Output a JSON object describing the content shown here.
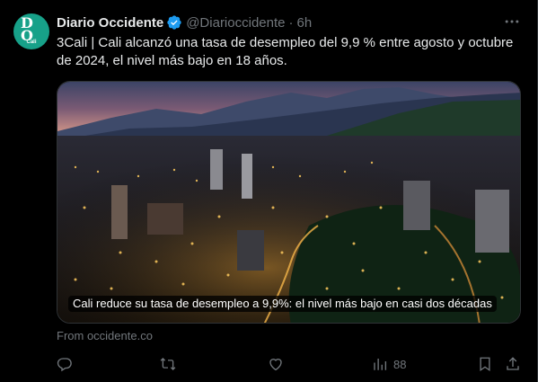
{
  "tweet": {
    "avatar": {
      "line1": "D",
      "line2": "O",
      "line3": "Cali",
      "bg_color": "#17a189"
    },
    "author_name": "Diario Occidente",
    "handle": "@Diarioccidente",
    "separator": "·",
    "time": "6h",
    "verified_color": "#1d9bf0",
    "body": "3Cali | Cali alcanzó una tasa de desempleo del 9,9 % entre agosto y octubre de 2024, el nivel más bajo en 18 años.",
    "card": {
      "title": "Cali reduce su tasa de desempleo a 9,9%: el nivel más bajo en casi dos décadas",
      "source": "From occidente.co"
    },
    "actions": {
      "reply_icon": "reply-icon",
      "retweet_icon": "retweet-icon",
      "like_icon": "heart-icon",
      "views_icon": "views-icon",
      "views_count": "88",
      "bookmark_icon": "bookmark-icon",
      "share_icon": "share-icon"
    }
  }
}
